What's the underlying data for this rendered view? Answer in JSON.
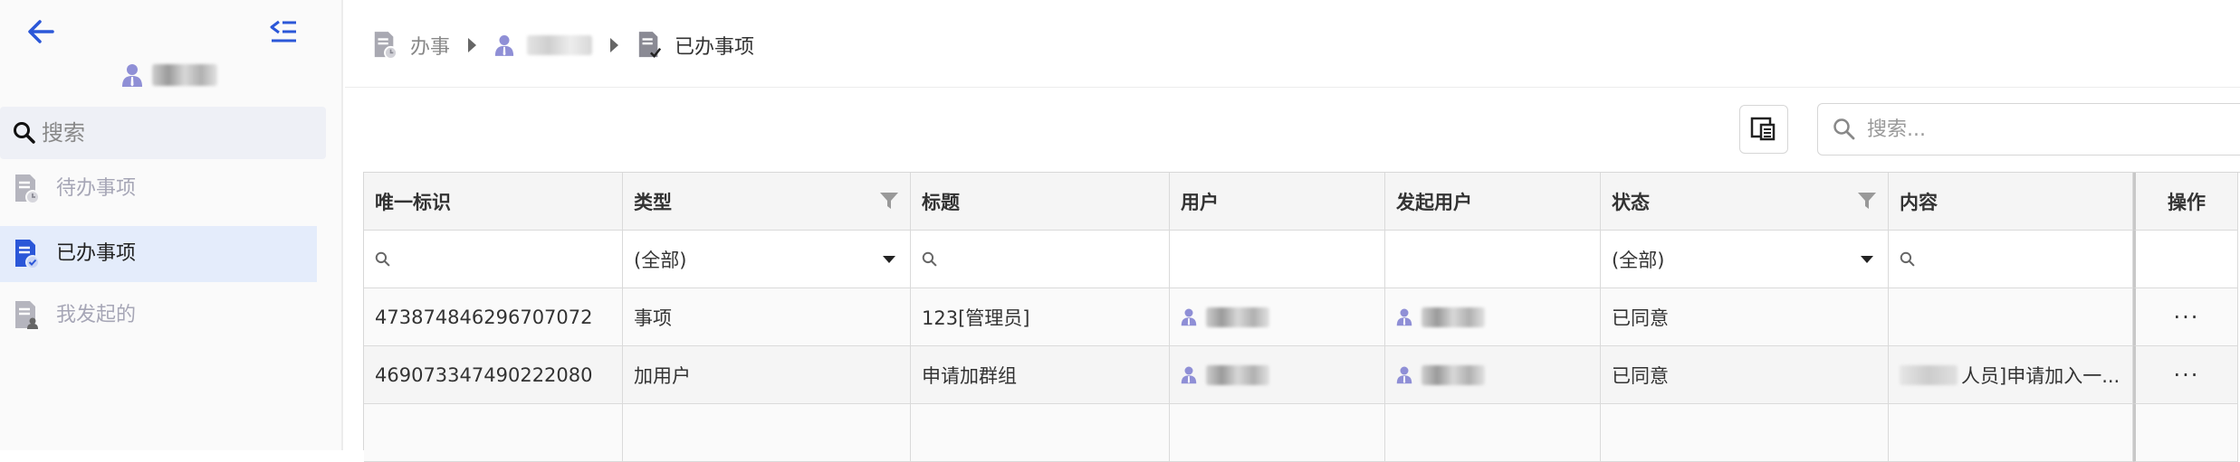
{
  "sidebar": {
    "search_placeholder": "搜索",
    "items": [
      {
        "label": "待办事项"
      },
      {
        "label": "已办事项"
      },
      {
        "label": "我发起的"
      }
    ]
  },
  "breadcrumb": {
    "root": "办事",
    "current": "已办事项"
  },
  "toolbar": {
    "search_placeholder": "搜索..."
  },
  "grid": {
    "columns": [
      "唯一标识",
      "类型",
      "标题",
      "用户",
      "发起用户",
      "状态",
      "内容",
      "操作"
    ],
    "filters": {
      "type": "(全部)",
      "status": "(全部)"
    },
    "rows": [
      {
        "id": "473874846296707072",
        "type": "事项",
        "title": "123[管理员]",
        "status": "已同意",
        "content": "",
        "ops": "···"
      },
      {
        "id": "469073347490222080",
        "type": "加用户",
        "title": "申请加群组",
        "status": "已同意",
        "content": "人员]申请加入一...",
        "ops": "···"
      }
    ]
  },
  "colors": {
    "accent": "#2b57d8",
    "user_icon": "#8f8fd6",
    "active_bg": "#e4ecfb"
  }
}
